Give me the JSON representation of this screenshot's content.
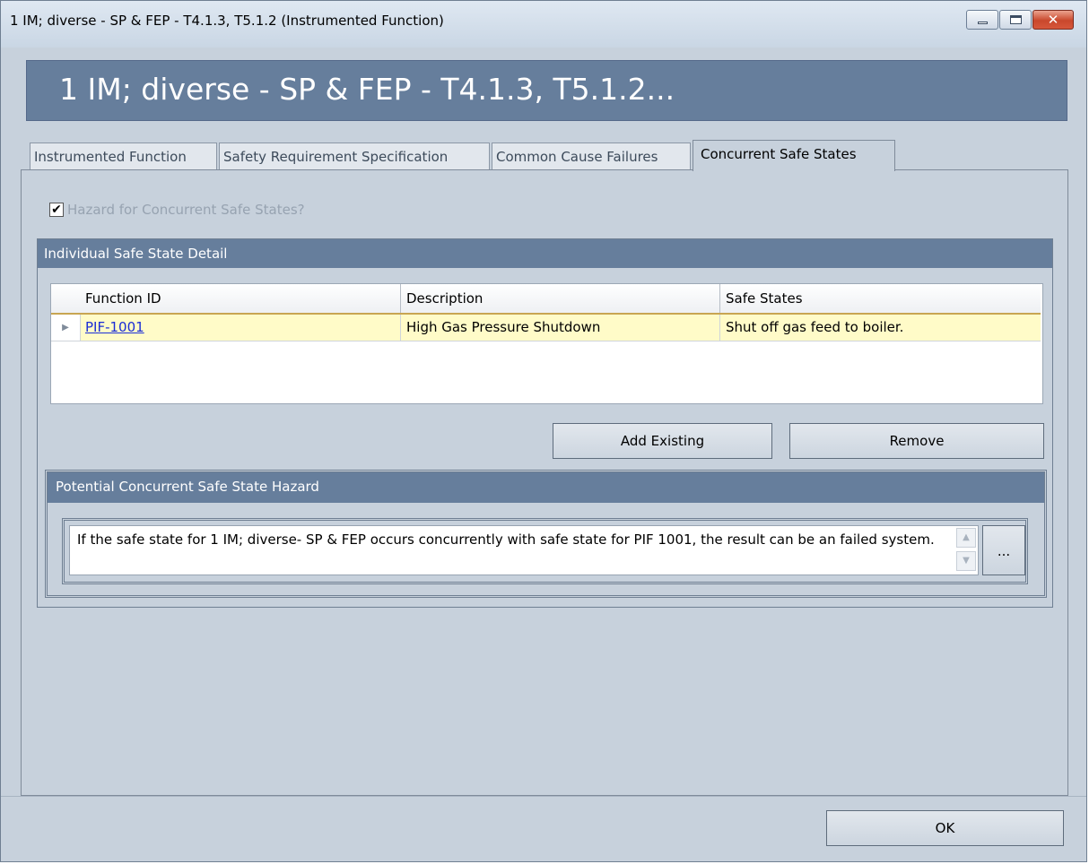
{
  "window": {
    "title": "1 IM; diverse - SP & FEP - T4.1.3, T5.1.2 (Instrumented Function)",
    "controls": {
      "minimize": "minimize-icon",
      "maximize": "maximize-icon",
      "close_glyph": "✕"
    }
  },
  "banner": {
    "title": "1 IM; diverse - SP & FEP - T4.1.3, T5.1.2..."
  },
  "tabs": [
    {
      "label": "Instrumented Function",
      "active": false
    },
    {
      "label": "Safety Requirement Specification",
      "active": false
    },
    {
      "label": "Common Cause Failures",
      "active": false
    },
    {
      "label": "Concurrent Safe States",
      "active": true
    }
  ],
  "hazard_checkbox": {
    "label": "Hazard for Concurrent Safe States?",
    "checked": true,
    "check_glyph": "✔"
  },
  "safe_state_detail": {
    "header": "Individual Safe State Detail",
    "columns": [
      "Function ID",
      "Description",
      "Safe States"
    ],
    "rows": [
      {
        "indicator": "▶",
        "function_id": "PIF-1001",
        "description": "High Gas Pressure Shutdown",
        "safe_states": "Shut off gas feed to boiler."
      }
    ],
    "buttons": {
      "add_existing": "Add Existing",
      "remove": "Remove"
    }
  },
  "hazard_section": {
    "header": "Potential Concurrent Safe State Hazard",
    "text": "If the safe state for 1 IM; diverse- SP & FEP occurs concurrently with safe state for PIF 1001, the result can be an failed system.",
    "ellipsis": "...",
    "scroll_up": "▲",
    "scroll_down": "▼"
  },
  "footer": {
    "ok": "OK"
  },
  "colors": {
    "panel": "#c7d1dc",
    "header": "#667e9c",
    "row_highlight": "#fffbc8",
    "link": "#1a2dd6"
  }
}
